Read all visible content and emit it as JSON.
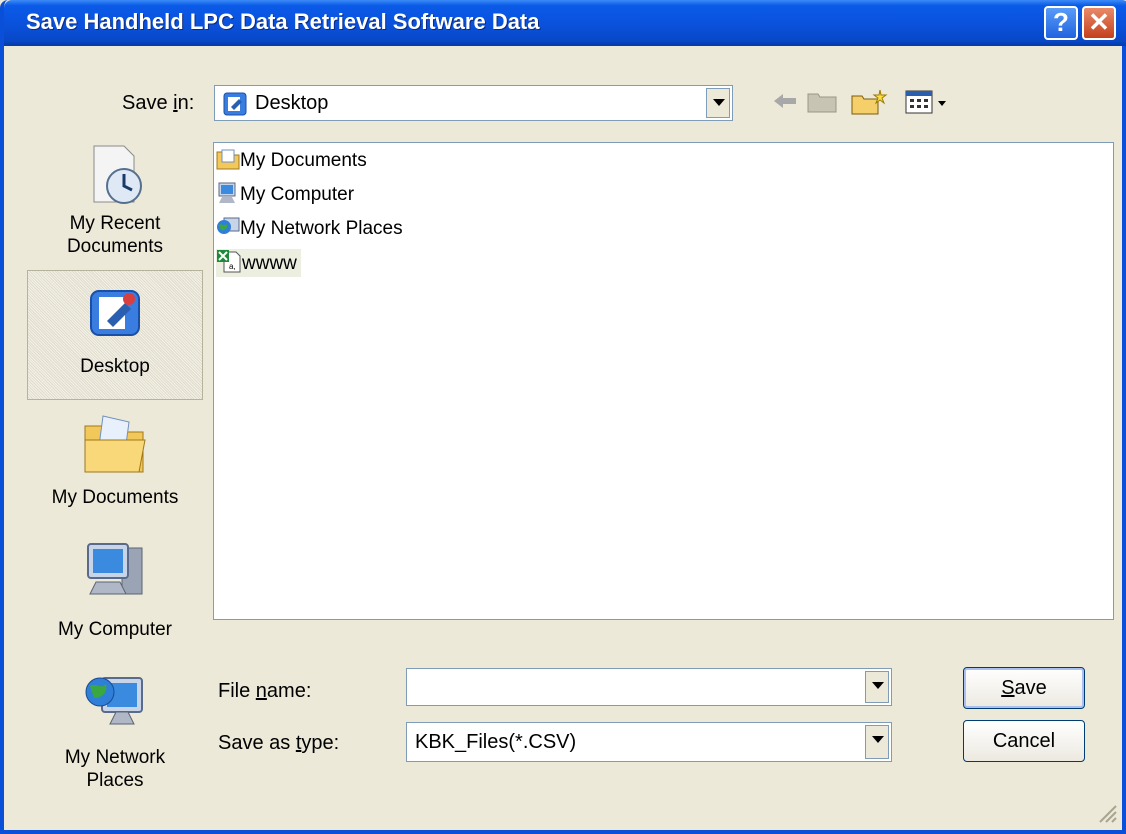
{
  "window": {
    "title": "Save Handheld LPC Data Retrieval Software Data",
    "help_glyph": "?",
    "close_glyph": "✕"
  },
  "save_in": {
    "label_pre": "Save ",
    "label_key": "i",
    "label_post": "n:",
    "value": "Desktop"
  },
  "places": [
    {
      "line1": "My Recent",
      "line2": "Documents",
      "icon": "recent-documents-icon"
    },
    {
      "line1": "Desktop",
      "line2": "",
      "icon": "desktop-icon"
    },
    {
      "line1": "My Documents",
      "line2": "",
      "icon": "my-documents-icon"
    },
    {
      "line1": "My Computer",
      "line2": "",
      "icon": "my-computer-icon"
    },
    {
      "line1": "My Network",
      "line2": "Places",
      "icon": "my-network-places-icon"
    }
  ],
  "files": [
    {
      "name": "My Documents",
      "icon": "my-documents-icon"
    },
    {
      "name": "My Computer",
      "icon": "my-computer-icon"
    },
    {
      "name": "My Network Places",
      "icon": "network-places-icon"
    },
    {
      "name": "wwww",
      "icon": "excel-csv-file-icon"
    }
  ],
  "file_name": {
    "label_pre": "File ",
    "label_key": "n",
    "label_post": "ame:",
    "value": ""
  },
  "save_as_type": {
    "label_pre": "Save as ",
    "label_key": "t",
    "label_post": "ype:",
    "value": "KBK_Files(*.CSV)"
  },
  "buttons": {
    "save_key": "S",
    "save_rest": "ave",
    "cancel": "Cancel"
  },
  "colors": {
    "title_bar": "#0a52dd",
    "dialog_bg": "#ece9d8",
    "close_button": "#c4401c"
  }
}
